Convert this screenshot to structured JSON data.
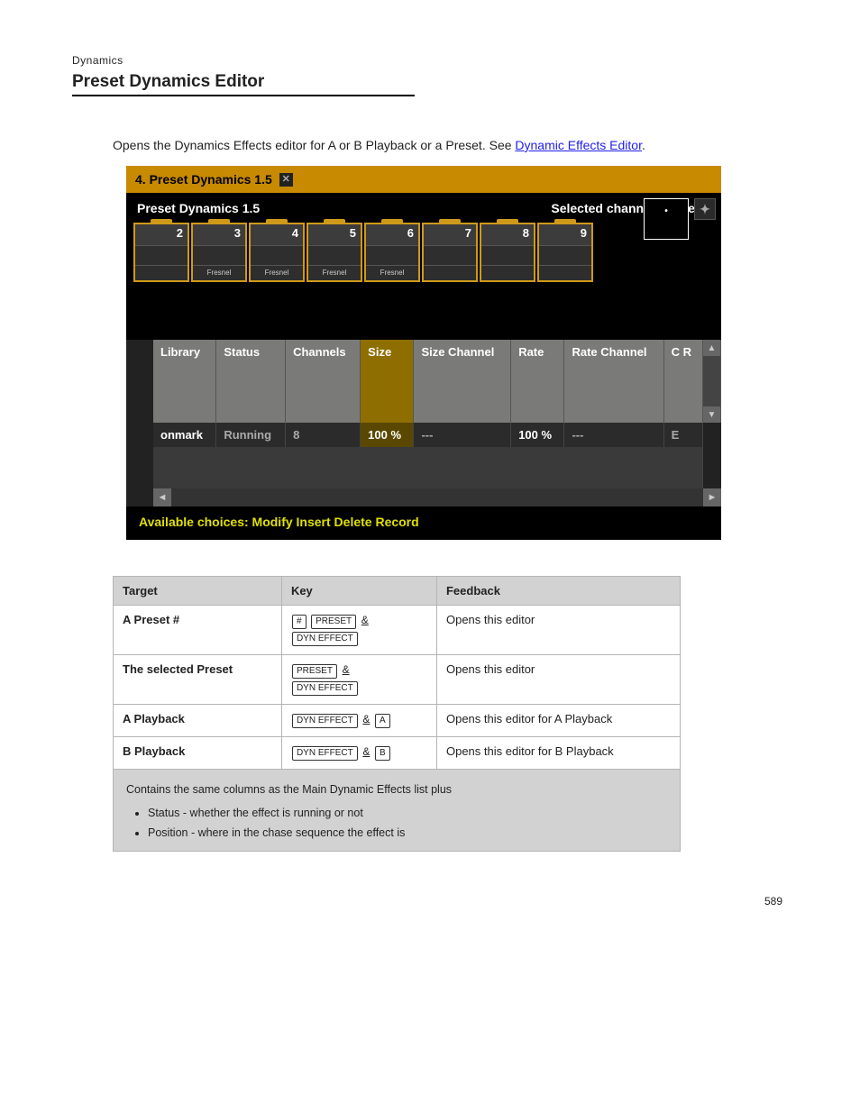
{
  "chapter": "Dynamics",
  "section_title": "Preset Dynamics Editor",
  "intro_prefix": "Opens the Dynamics Effects editor for A or B Playback or a Preset. See ",
  "intro_link": "Dynamic Effects Editor",
  "intro_suffix": ".",
  "screenshot": {
    "titlebar": "4. Preset Dynamics 1.5",
    "header_left": "Preset Dynamics 1.5",
    "header_right": "Selected channels (Palette",
    "channels": [
      {
        "num": "2",
        "type": ""
      },
      {
        "num": "3",
        "type": "Fresnel"
      },
      {
        "num": "4",
        "type": "Fresnel"
      },
      {
        "num": "5",
        "type": "Fresnel"
      },
      {
        "num": "6",
        "type": "Fresnel"
      },
      {
        "num": "7",
        "type": ""
      },
      {
        "num": "8",
        "type": ""
      },
      {
        "num": "9",
        "type": ""
      }
    ],
    "table_headers": [
      "Library",
      "Status",
      "Channels",
      "Size",
      "Size Channel",
      "Rate",
      "Rate Channel",
      "C R"
    ],
    "row": {
      "library": "onmark",
      "status": "Running",
      "channels": "8",
      "size": "100 %",
      "size_channel": "---",
      "rate": "100 %",
      "rate_channel": "---",
      "last": "E"
    },
    "available": "Available choices: Modify Insert Delete Record"
  },
  "summary": {
    "headers": [
      "Target",
      "Key",
      "Feedback"
    ],
    "rows": [
      {
        "target": "A Preset #",
        "keys": [
          [
            "#",
            "PRESET",
            "&"
          ],
          [
            "DYN EFFECT"
          ]
        ],
        "feedback": "Opens this editor"
      },
      {
        "target": "The selected Preset",
        "keys": [
          [
            "PRESET",
            "&"
          ],
          [
            "DYN EFFECT"
          ]
        ],
        "feedback": "Opens this editor"
      },
      {
        "target": "A Playback",
        "keys": [
          [
            "DYN EFFECT",
            "&",
            "A"
          ]
        ],
        "feedback": "Opens this editor for A Playback"
      },
      {
        "target": "B Playback",
        "keys": [
          [
            "DYN EFFECT",
            "&",
            "B"
          ]
        ],
        "feedback": "Opens this editor for B Playback"
      }
    ],
    "footer_intro": "Contains the same columns as the Main Dynamic Effects list plus",
    "footer_items": [
      "Status - whether the effect is running or not",
      "Position - where in the chase sequence the effect is"
    ]
  },
  "page_number": "589"
}
